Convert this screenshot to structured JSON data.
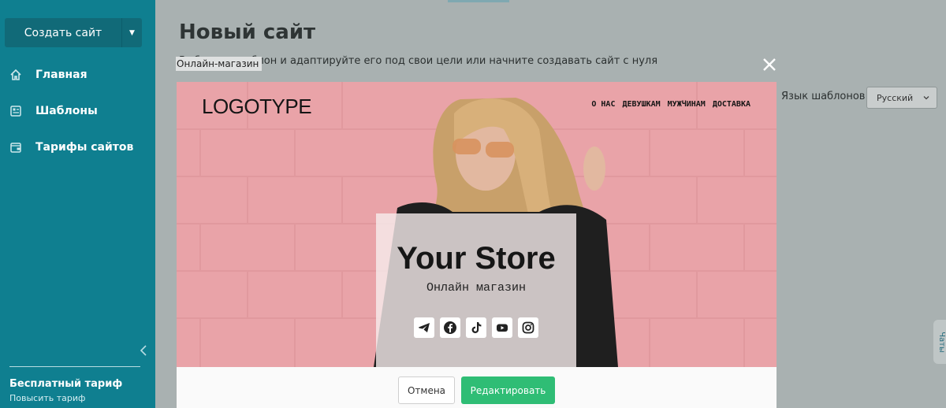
{
  "sidebar": {
    "create_button": "Создать сайт",
    "items": [
      {
        "label": "Главная",
        "icon": "home-icon"
      },
      {
        "label": "Шаблоны",
        "icon": "templates-icon"
      },
      {
        "label": "Тарифы сайтов",
        "icon": "wallet-icon"
      }
    ],
    "plan_title": "Бесплатный тариф",
    "plan_link": "Повысить тариф"
  },
  "main": {
    "title": "Новый сайт",
    "subtitle": "Выберите шаблон и адаптируйте его под свои цели или начните создавать сайт с нуля",
    "lang_label": "Язык шаблонов:",
    "lang_value": "Русский",
    "chat_tab": "Чаты"
  },
  "modal": {
    "label": "Онлайн-магазин",
    "preview": {
      "logo": "LOGOTYPE",
      "nav": [
        "О НАС",
        "ДЕВУШКАМ",
        "МУЖЧИНАМ",
        "ДОСТАВКА"
      ],
      "hero_title": "Your Store",
      "hero_subtitle": "Онлайн магазин",
      "socials": [
        "telegram-icon",
        "facebook-icon",
        "tiktok-icon",
        "youtube-icon",
        "instagram-icon"
      ]
    },
    "cancel": "Отмена",
    "edit": "Редактировать"
  },
  "colors": {
    "sidebar": "#0f7f90",
    "primary_button": "#2fbd75",
    "preview_background": "#e9a3a8"
  }
}
